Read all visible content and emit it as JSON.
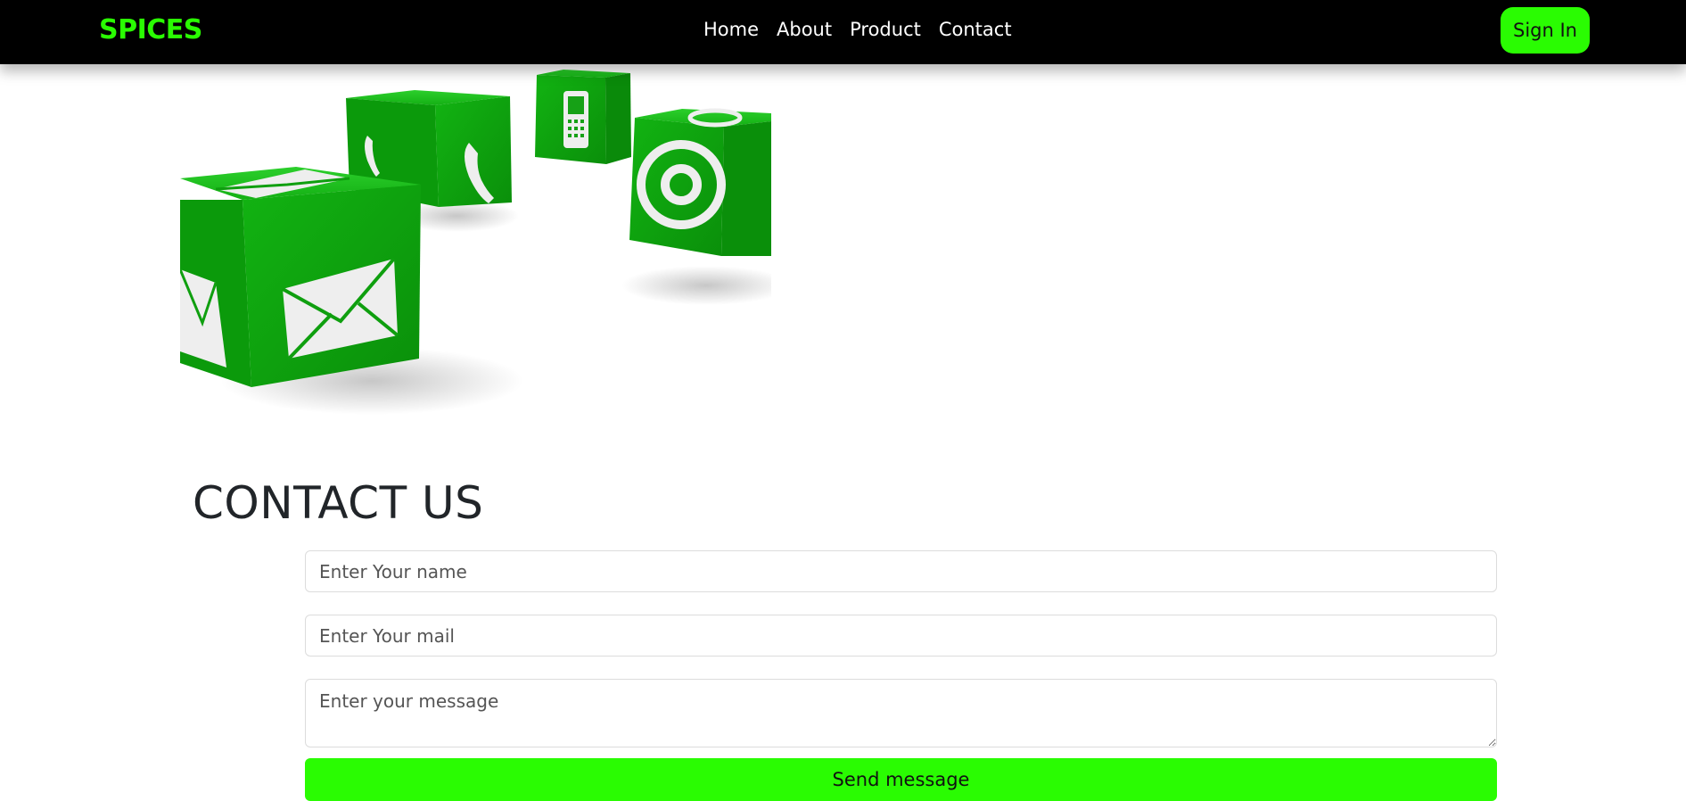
{
  "brand": "SPICES",
  "nav": {
    "links": [
      "Home",
      "About",
      "Product",
      "Contact"
    ],
    "signin_label": "Sign In"
  },
  "hero": {
    "image": "green-contact-cubes",
    "accent": "#0fa30f"
  },
  "contact": {
    "title": "CONTACT US",
    "name_placeholder": "Enter Your name",
    "mail_placeholder": "Enter Your mail",
    "message_placeholder": "Enter your message",
    "send_label": "Send message"
  },
  "colors": {
    "navbar": "#000000",
    "accent": "#2afc02",
    "brand": "#2afc02"
  }
}
